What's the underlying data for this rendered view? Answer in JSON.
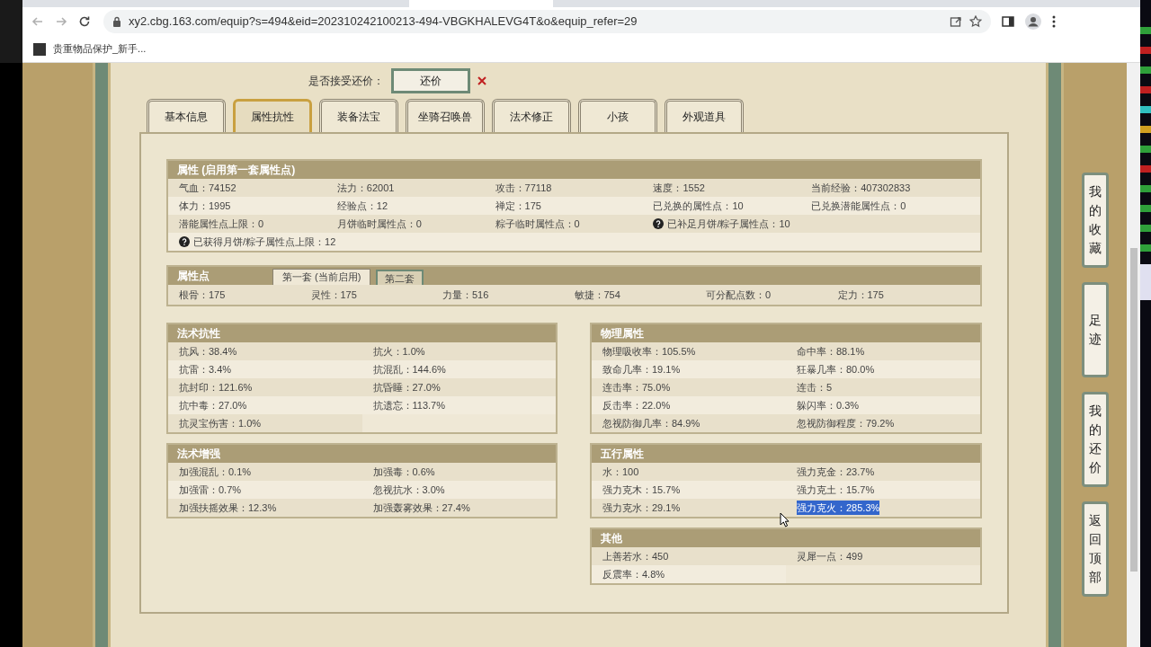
{
  "browser": {
    "url": "xy2.cbg.163.com/equip?s=494&eid=202310242100213-494-VBGKHALEVG4T&o&equip_refer=29",
    "bookmark": "贵重物品保护_新手..."
  },
  "offer": {
    "label": "是否接受还价：",
    "button": "还价"
  },
  "tabs": [
    {
      "label": "基本信息",
      "selected": false
    },
    {
      "label": "属性抗性",
      "selected": true
    },
    {
      "label": "装备法宝",
      "selected": false
    },
    {
      "label": "坐骑召唤兽",
      "selected": false
    },
    {
      "label": "法术修正",
      "selected": false
    },
    {
      "label": "小孩",
      "selected": false
    },
    {
      "label": "外观道具",
      "selected": false
    }
  ],
  "attributes": {
    "title": "属性 (启用第一套属性点)",
    "rows": [
      [
        {
          "text": "气血：74152",
          "help": false
        },
        {
          "text": "法力：62001",
          "help": false
        },
        {
          "text": "攻击：77118",
          "help": false
        },
        {
          "text": "速度：1552",
          "help": false
        },
        {
          "text": "当前经验：407302833",
          "help": false
        }
      ],
      [
        {
          "text": "体力：1995",
          "help": false
        },
        {
          "text": "经验点：12",
          "help": false
        },
        {
          "text": "禅定：175",
          "help": false
        },
        {
          "text": "已兑换的属性点：10",
          "help": false
        },
        {
          "text": "已兑换潜能属性点：0",
          "help": false
        }
      ],
      [
        {
          "text": "潜能属性点上限：0",
          "help": false
        },
        {
          "text": "月饼临时属性点：0",
          "help": false
        },
        {
          "text": "粽子临时属性点：0",
          "help": false
        },
        {
          "text": "已补足月饼/粽子属性点：10",
          "help": true
        }
      ],
      [
        {
          "text": "已获得月饼/粽子属性点上限：12",
          "help": true
        }
      ]
    ]
  },
  "points": {
    "title": "属性点",
    "sets": [
      {
        "label": "第一套 (当前启用)",
        "selected": true
      },
      {
        "label": "第二套",
        "selected": false
      }
    ],
    "values": [
      "根骨：175",
      "灵性：175",
      "力量：516",
      "敏捷：754",
      "可分配点数：0",
      "定力：175"
    ]
  },
  "left_panels": [
    {
      "title": "法术抗性",
      "items": [
        {
          "text": "抗风：38.4%",
          "highlighted": false
        },
        {
          "text": "抗火：1.0%",
          "highlighted": false
        },
        {
          "text": "抗雷：3.4%",
          "highlighted": false
        },
        {
          "text": "抗混乱：144.6%",
          "highlighted": false
        },
        {
          "text": "抗封印：121.6%",
          "highlighted": false
        },
        {
          "text": "抗昏睡：27.0%",
          "highlighted": false
        },
        {
          "text": "抗中毒：27.0%",
          "highlighted": false
        },
        {
          "text": "抗遗忘：113.7%",
          "highlighted": false
        },
        {
          "text": "抗灵宝伤害：1.0%",
          "highlighted": false
        }
      ]
    },
    {
      "title": "法术增强",
      "items": [
        {
          "text": "加强混乱：0.1%",
          "highlighted": false
        },
        {
          "text": "加强毒：0.6%",
          "highlighted": false
        },
        {
          "text": "加强雷：0.7%",
          "highlighted": false
        },
        {
          "text": "忽视抗水：3.0%",
          "highlighted": false
        },
        {
          "text": "加强扶摇效果：12.3%",
          "highlighted": false
        },
        {
          "text": "加强轰雾效果：27.4%",
          "highlighted": false
        }
      ]
    }
  ],
  "right_panels": [
    {
      "title": "物理属性",
      "items": [
        {
          "text": "物理吸收率：105.5%",
          "highlighted": false
        },
        {
          "text": "命中率：88.1%",
          "highlighted": false
        },
        {
          "text": "致命几率：19.1%",
          "highlighted": false
        },
        {
          "text": "狂暴几率：80.0%",
          "highlighted": false
        },
        {
          "text": "连击率：75.0%",
          "highlighted": false
        },
        {
          "text": "连击：5",
          "highlighted": false
        },
        {
          "text": "反击率：22.0%",
          "highlighted": false
        },
        {
          "text": "躲闪率：0.3%",
          "highlighted": false
        },
        {
          "text": "忽视防御几率：84.9%",
          "highlighted": false
        },
        {
          "text": "忽视防御程度：79.2%",
          "highlighted": false
        }
      ]
    },
    {
      "title": "五行属性",
      "items": [
        {
          "text": "水：100",
          "highlighted": false
        },
        {
          "text": "强力克金：23.7%",
          "highlighted": false
        },
        {
          "text": "强力克木：15.7%",
          "highlighted": false
        },
        {
          "text": "强力克土：15.7%",
          "highlighted": false
        },
        {
          "text": "强力克水：29.1%",
          "highlighted": false
        },
        {
          "text": "强力克火：285.3%",
          "highlighted": true
        }
      ]
    },
    {
      "title": "其他",
      "items": [
        {
          "text": "上善若水：450",
          "highlighted": false
        },
        {
          "text": "灵犀一点：499",
          "highlighted": false
        },
        {
          "text": "反震率：4.8%",
          "highlighted": false
        }
      ]
    }
  ],
  "side_buttons": [
    "我的收藏",
    "足迹",
    "我的还价",
    "返回顶部"
  ]
}
